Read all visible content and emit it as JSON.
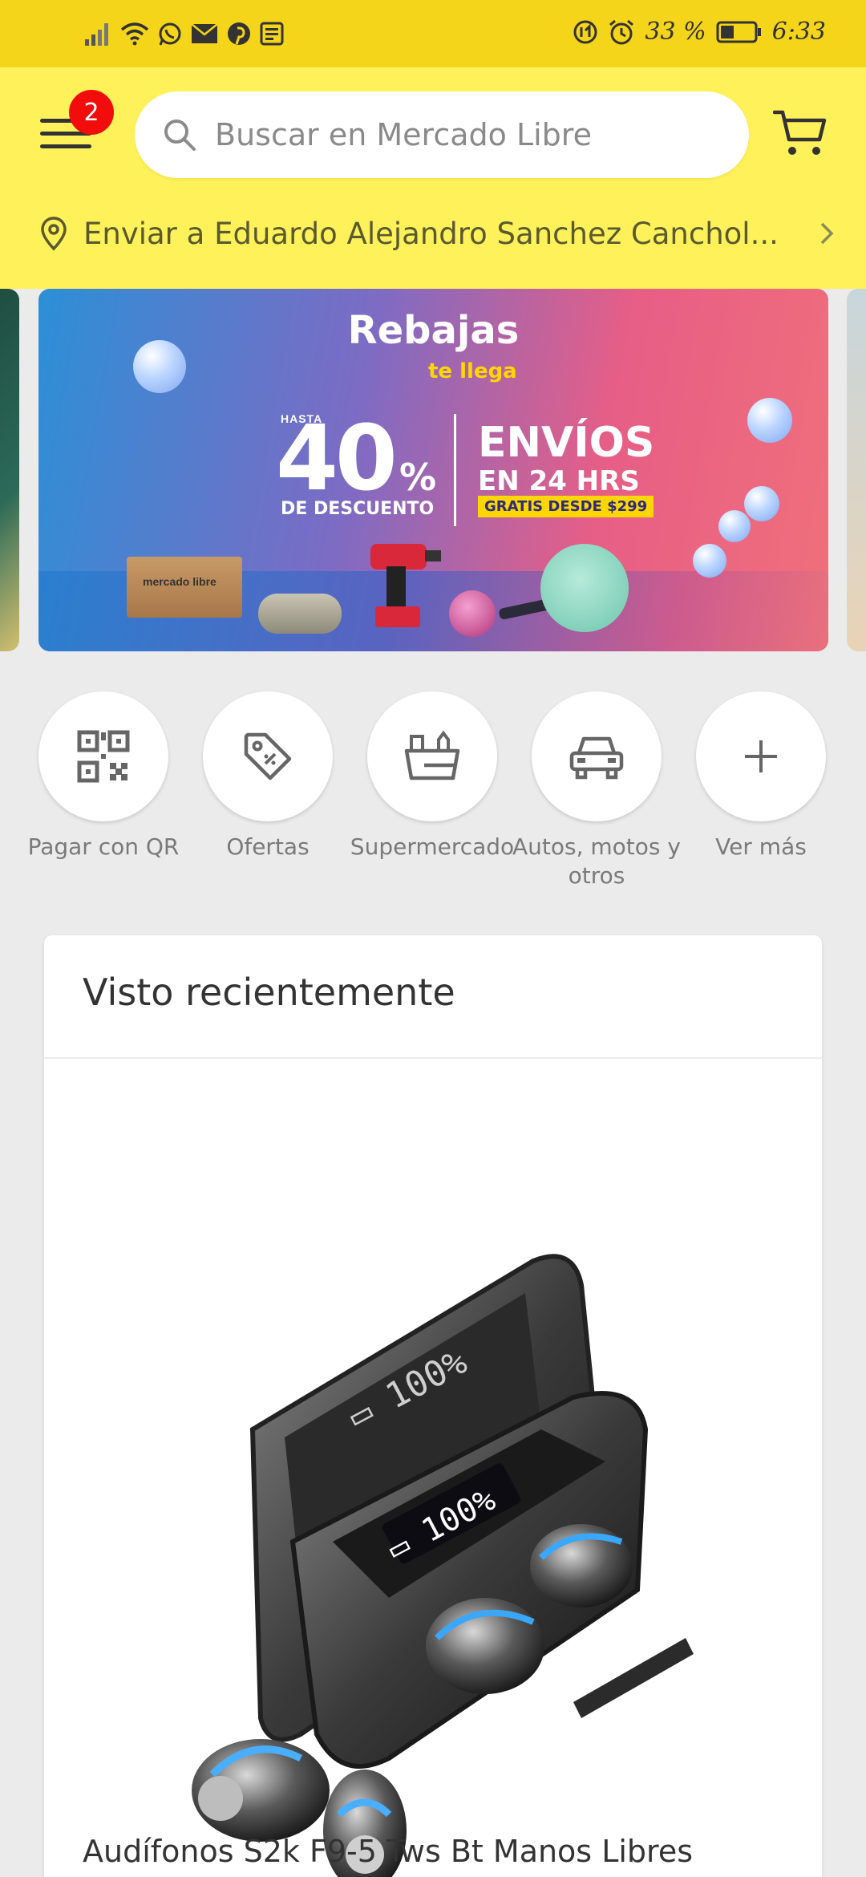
{
  "status_bar": {
    "battery": "33 %",
    "time": "6:33"
  },
  "header": {
    "menu_badge": "2",
    "search_placeholder": "Buscar en Mercado Libre",
    "address": "Enviar a Eduardo Alejandro Sanchez Canchol..."
  },
  "banner": {
    "title": "Rebajas",
    "subtitle": "te llega",
    "hasta": "HASTA",
    "percent": "40",
    "percent_sign": "%",
    "discount_label": "DE DESCUENTO",
    "envios": "ENVÍOS",
    "envios_time": "EN 24 HRS",
    "gratis": "GRATIS DESDE $299",
    "box_brand": "mercado libre"
  },
  "shortcuts": [
    {
      "label": "Pagar con QR",
      "icon": "qr-code-icon"
    },
    {
      "label": "Ofertas",
      "icon": "price-tag-icon"
    },
    {
      "label": "Supermercado",
      "icon": "grocery-basket-icon"
    },
    {
      "label": "Autos, motos y otros",
      "icon": "car-icon"
    },
    {
      "label": "Ver más",
      "icon": "plus-icon"
    }
  ],
  "recently_viewed": {
    "title": "Visto recientemente",
    "product_title": "Audífonos S2k F9-5 Tws Bt Manos Libres"
  },
  "colors": {
    "header_yellow": "#fff159",
    "status_yellow": "#f5d51a",
    "badge_red": "#f20c0c",
    "background": "#ebebeb"
  }
}
